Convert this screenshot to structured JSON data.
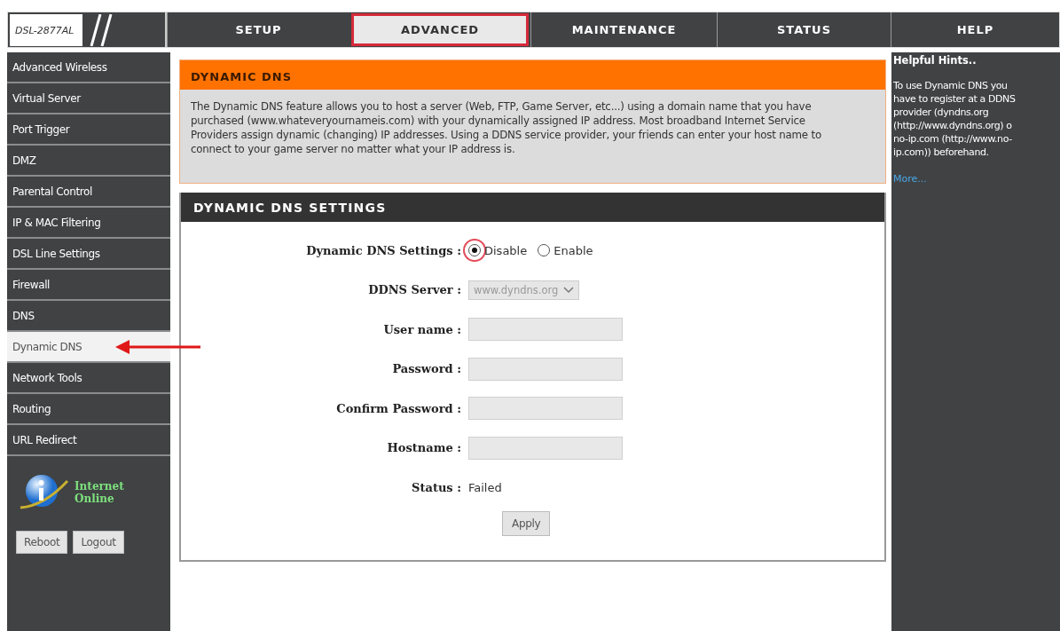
{
  "logo": {
    "model": "DSL-2877AL"
  },
  "tabs": [
    {
      "label": "SETUP",
      "selected": false
    },
    {
      "label": "ADVANCED",
      "selected": true
    },
    {
      "label": "MAINTENANCE",
      "selected": false
    },
    {
      "label": "STATUS",
      "selected": false
    },
    {
      "label": "HELP",
      "selected": false
    }
  ],
  "sidebar": {
    "items": [
      {
        "label": "Advanced Wireless",
        "selected": false
      },
      {
        "label": "Virtual Server",
        "selected": false
      },
      {
        "label": "Port Trigger",
        "selected": false
      },
      {
        "label": "DMZ",
        "selected": false
      },
      {
        "label": "Parental Control",
        "selected": false
      },
      {
        "label": "IP & MAC Filtering",
        "selected": false
      },
      {
        "label": "DSL Line Settings",
        "selected": false
      },
      {
        "label": "Firewall",
        "selected": false
      },
      {
        "label": "DNS",
        "selected": false
      },
      {
        "label": "Dynamic DNS",
        "selected": true
      },
      {
        "label": "Network Tools",
        "selected": false
      },
      {
        "label": "Routing",
        "selected": false
      },
      {
        "label": "URL Redirect",
        "selected": false
      }
    ],
    "internet_status": [
      "Internet",
      "Online"
    ],
    "buttons": [
      "Reboot",
      "Logout"
    ]
  },
  "intro": {
    "title": "DYNAMIC DNS",
    "text": "The Dynamic DNS feature allows you to host a server (Web, FTP, Game Server, etc...) using a domain name that you have purchased (www.whateveryournameis.com) with your dynamically assigned IP address. Most broadband Internet Service Providers assign dynamic (changing) IP addresses. Using a DDNS service provider, your friends can enter your host name to connect to your game server no matter what your IP address is."
  },
  "settings": {
    "title": "DYNAMIC DNS SETTINGS",
    "rows": [
      {
        "kind": "radio",
        "label": "Dynamic DNS Settings :",
        "options": [
          {
            "label": "Disable",
            "selected": true
          },
          {
            "label": "Enable",
            "selected": false
          }
        ]
      },
      {
        "kind": "select",
        "label": "DDNS Server :",
        "value": "www.dyndns.org"
      },
      {
        "kind": "input",
        "label": "User name :"
      },
      {
        "kind": "input",
        "label": "Password :"
      },
      {
        "kind": "input",
        "label": "Confirm Password :"
      },
      {
        "kind": "input",
        "label": "Hostname :"
      },
      {
        "kind": "text",
        "label": "Status :",
        "value": "Failed"
      }
    ],
    "apply": "Apply"
  },
  "hints": {
    "title": "Helpful Hints..",
    "lines": [
      "To use Dynamic DNS you",
      "have to register at a DDNS",
      "provider (dyndns.org",
      "(http://www.dyndns.org) o",
      "no-ip.com (http://www.no-",
      "ip.com)) beforehand."
    ],
    "more": "More..."
  }
}
